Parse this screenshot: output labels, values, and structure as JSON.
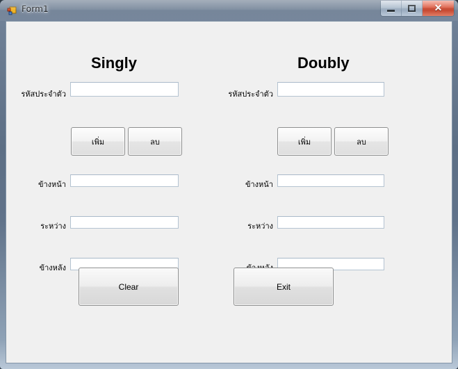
{
  "window": {
    "title": "Form1",
    "icon": "form-icon",
    "buttons": {
      "minimize": "minimize-button",
      "maximize": "maximize-button",
      "close_glyph": "✕"
    }
  },
  "form": {
    "columns": [
      {
        "heading": "Singly",
        "id_label": "รหัสประจำตัว",
        "id_value": "",
        "add_button": "เพิ่ม",
        "delete_button": "ลบ",
        "fields": [
          {
            "label": "ข้างหน้า",
            "value": ""
          },
          {
            "label": "ระหว่าง",
            "value": ""
          },
          {
            "label": "ข้างหลัง",
            "value": ""
          }
        ],
        "action_button": "Clear"
      },
      {
        "heading": "Doubly",
        "id_label": "รหัสประจำตัว",
        "id_value": "",
        "add_button": "เพิ่ม",
        "delete_button": "ลบ",
        "fields": [
          {
            "label": "ข้างหน้า",
            "value": ""
          },
          {
            "label": "ระหว่าง",
            "value": ""
          },
          {
            "label": "ข้างหลัง",
            "value": ""
          }
        ],
        "action_button": "Exit"
      }
    ]
  },
  "colors": {
    "client_background": "#f0f0f0",
    "textbox_border": "#b4c3d1",
    "close_button": "#c03a22",
    "frame": "#5d6f85"
  }
}
